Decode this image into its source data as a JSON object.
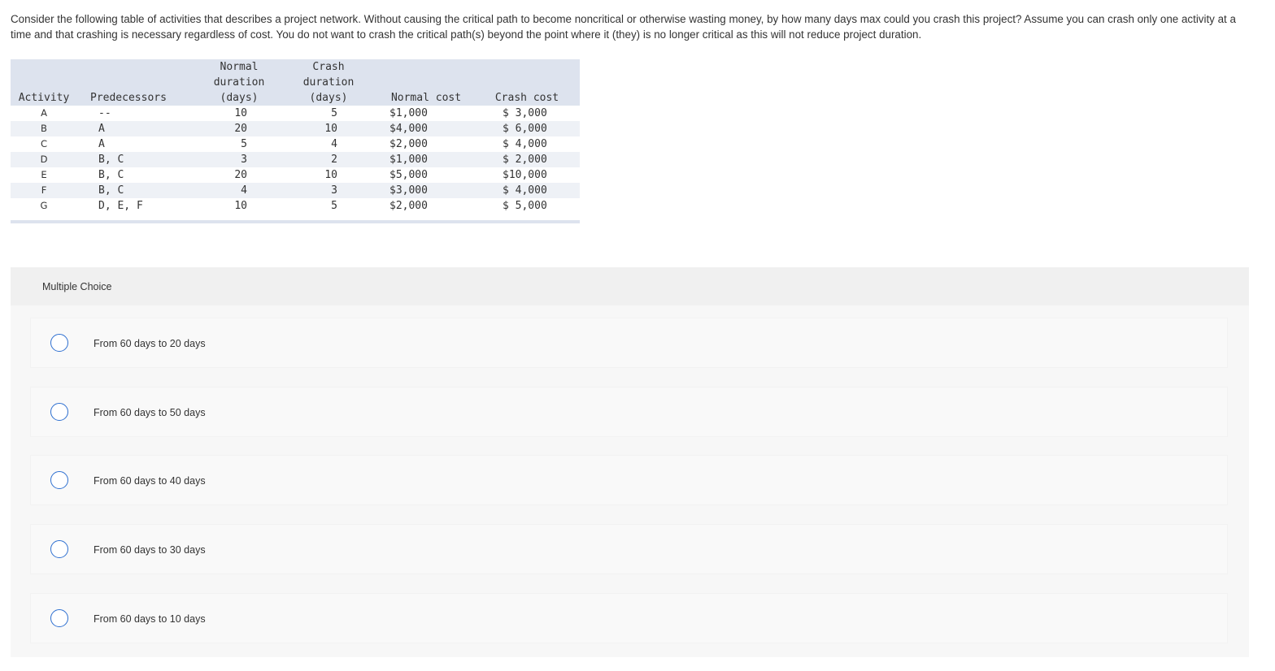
{
  "question": {
    "text": "Consider the following table of activities that describes a project network. Without causing the critical path to become noncritical or otherwise wasting money, by how many days max could you crash this project? Assume you can crash only one activity at a time and that crashing is necessary regardless of cost. You do not want to crash the critical path(s) beyond the point where it (they) is no longer critical as this will not reduce project duration."
  },
  "table": {
    "headers": {
      "activity": "Activity",
      "predecessors": "Predecessors",
      "normal_duration": "Normal\nduration\n(days)",
      "crash_duration": "Crash\nduration\n(days)",
      "normal_cost": "Normal cost",
      "crash_cost": "Crash cost"
    },
    "rows": [
      {
        "activity": "A",
        "predecessors": "--",
        "normal_duration": "10",
        "crash_duration": "5",
        "normal_cost": "$1,000",
        "crash_cost": "$ 3,000"
      },
      {
        "activity": "B",
        "predecessors": "A",
        "normal_duration": "20",
        "crash_duration": "10",
        "normal_cost": "$4,000",
        "crash_cost": "$ 6,000"
      },
      {
        "activity": "C",
        "predecessors": "A",
        "normal_duration": "5",
        "crash_duration": "4",
        "normal_cost": "$2,000",
        "crash_cost": "$ 4,000"
      },
      {
        "activity": "D",
        "predecessors": "B, C",
        "normal_duration": "3",
        "crash_duration": "2",
        "normal_cost": "$1,000",
        "crash_cost": "$ 2,000"
      },
      {
        "activity": "E",
        "predecessors": "B, C",
        "normal_duration": "20",
        "crash_duration": "10",
        "normal_cost": "$5,000",
        "crash_cost": "$10,000"
      },
      {
        "activity": "F",
        "predecessors": "B, C",
        "normal_duration": "4",
        "crash_duration": "3",
        "normal_cost": "$3,000",
        "crash_cost": "$ 4,000"
      },
      {
        "activity": "G",
        "predecessors": "D, E, F",
        "normal_duration": "10",
        "crash_duration": "5",
        "normal_cost": "$2,000",
        "crash_cost": "$ 5,000"
      }
    ]
  },
  "multiple_choice": {
    "label": "Multiple Choice",
    "choices": [
      {
        "text": "From 60 days to 20 days"
      },
      {
        "text": "From 60 days to 50 days"
      },
      {
        "text": "From 60 days to 40 days"
      },
      {
        "text": "From 60 days to 30 days"
      },
      {
        "text": "From 60 days to 10 days"
      }
    ]
  },
  "colors": {
    "table_header_bg": "#dde3ee",
    "row_shade": "#eef1f6",
    "radio_border": "#2d6fd0",
    "panel_bg": "#f7f7f7"
  }
}
